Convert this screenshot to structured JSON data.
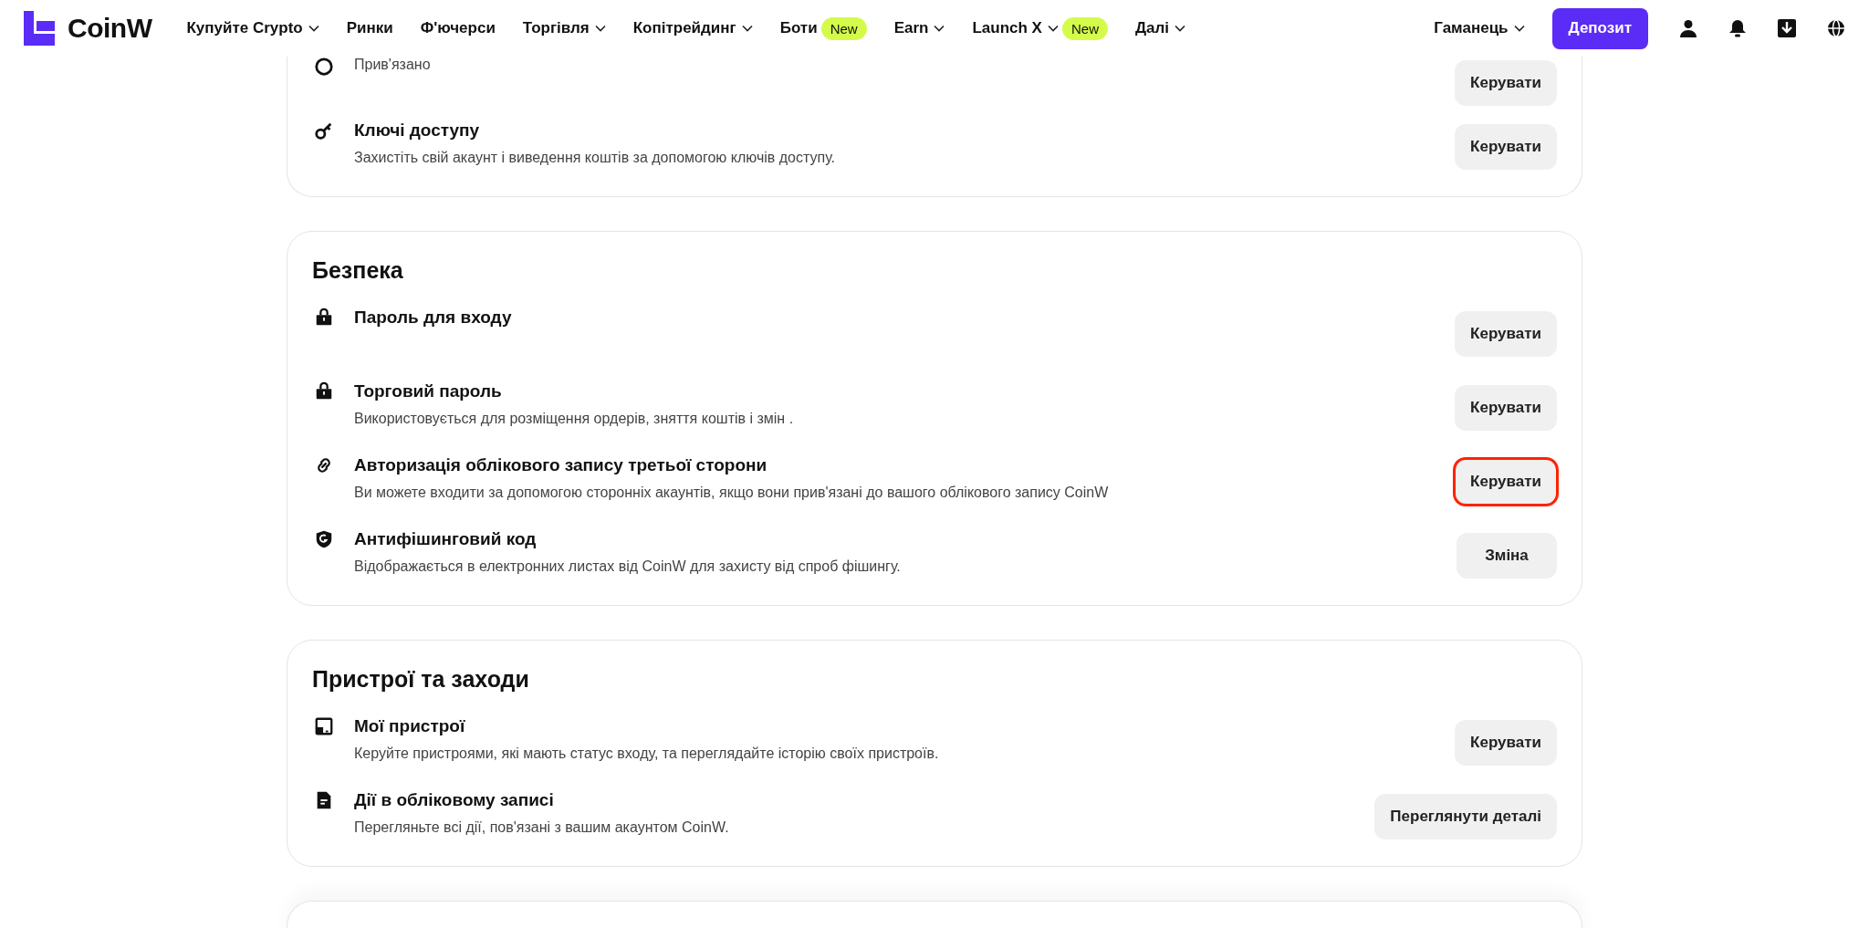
{
  "header": {
    "logo": "CoinW",
    "nav": [
      {
        "label": "Купуйте Crypto",
        "dropdown": true
      },
      {
        "label": "Ринки",
        "dropdown": false
      },
      {
        "label": "Ф'ючерси",
        "dropdown": false
      },
      {
        "label": "Торгівля",
        "dropdown": true
      },
      {
        "label": "Копітрейдинг",
        "dropdown": true
      },
      {
        "label": "Боти",
        "dropdown": false,
        "badge": "New"
      },
      {
        "label": "Earn",
        "dropdown": true
      },
      {
        "label": "Launch X",
        "dropdown": true,
        "badge": "New"
      },
      {
        "label": "Далі",
        "dropdown": true
      }
    ],
    "wallet": "Гаманець",
    "deposit": "Депозит"
  },
  "sections": [
    {
      "kind": "cut-top",
      "rows": [
        {
          "kind": "google",
          "description": "Прив'язано",
          "button": "Керувати",
          "highlighted": false
        },
        {
          "kind": "key",
          "title": "Ключі доступу",
          "description": "Захистіть свій акаунт і виведення коштів за допомогою ключів доступу.",
          "button": "Керувати",
          "highlighted": false
        }
      ]
    },
    {
      "kind": "full",
      "title": "Безпека",
      "rows": [
        {
          "kind": "lock",
          "title": "Пароль для входу",
          "button": "Керувати",
          "highlighted": false
        },
        {
          "kind": "lock",
          "title": "Торговий пароль",
          "description": "Використовується для розміщення ордерів, зняття коштів і змін .",
          "button": "Керувати",
          "highlighted": false
        },
        {
          "kind": "link",
          "title": "Авторизація облікового запису третьої сторони",
          "description": "Ви можете входити за допомогою сторонніх акаунтів, якщо вони прив'язані до вашого облікового запису CoinW",
          "button": "Керувати",
          "highlighted": true
        },
        {
          "kind": "shield",
          "title": "Антифішинговий код",
          "description": "Відображається в електронних листах від CoinW для захисту від спроб фішингу.",
          "button": "Зміна",
          "highlighted": false
        }
      ]
    },
    {
      "kind": "full",
      "title": "Пристрої та заходи",
      "rows": [
        {
          "kind": "device",
          "title": "Мої пристрої",
          "description": "Керуйте пристроями, які мають статус входу, та переглядайте історію своїх пристроїв.",
          "button": "Керувати",
          "highlighted": false
        },
        {
          "kind": "document",
          "title": "Дії в обліковому записі",
          "description": "Перегляньте всі дії, пов'язані з вашим акаунтом CoinW.",
          "button": "Переглянути деталі",
          "highlighted": false
        }
      ]
    },
    {
      "kind": "cut-bottom"
    }
  ]
}
